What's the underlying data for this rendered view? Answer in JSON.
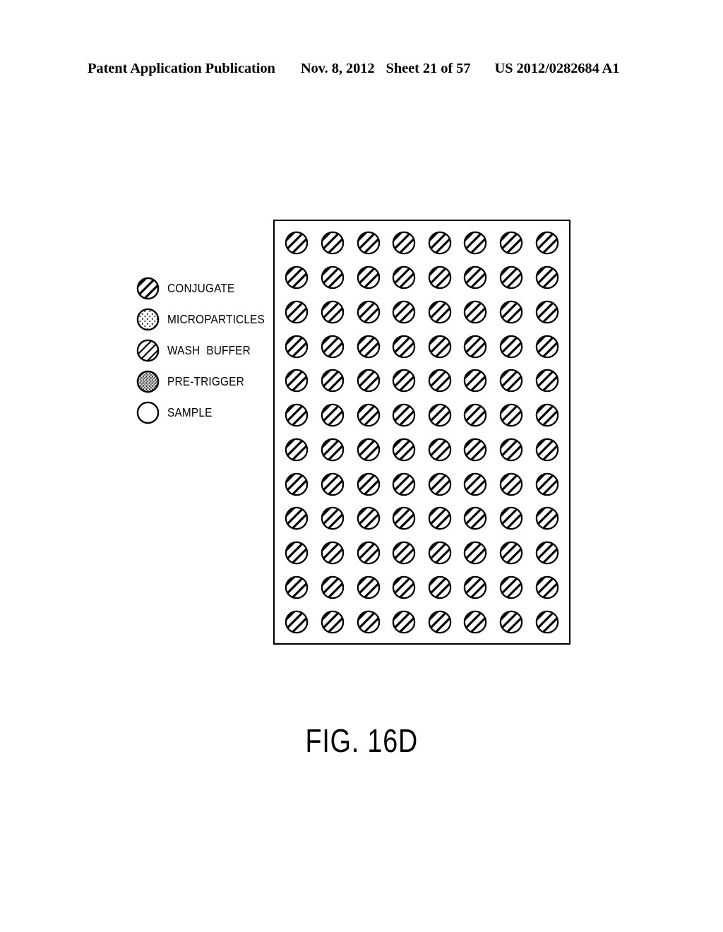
{
  "header": {
    "publication": "Patent Application Publication",
    "date": "Nov. 8, 2012",
    "sheet": "Sheet 21 of 57",
    "doc_number": "US 2012/0282684 A1"
  },
  "figure": {
    "caption": "FIG. 16D"
  },
  "legend": {
    "items": [
      {
        "label": "CONJUGATE",
        "pattern": "diagonal-stripes-thick",
        "icon": "conjugate-swatch-icon"
      },
      {
        "label": "MICROPARTICLES",
        "pattern": "sparse-dots",
        "icon": "microparticles-swatch-icon"
      },
      {
        "label": "WASH  BUFFER",
        "pattern": "diagonal-stripes-thin",
        "icon": "wash-buffer-swatch-icon"
      },
      {
        "label": "PRE-TRIGGER",
        "pattern": "dense-stipple",
        "icon": "pre-trigger-swatch-icon"
      },
      {
        "label": "SAMPLE",
        "pattern": "empty",
        "icon": "sample-swatch-icon"
      }
    ]
  },
  "plate": {
    "columns": 8,
    "rows": 12,
    "well_count": 96,
    "well_fill": "diagonal-stripes-thick",
    "well_fill_label": "CONJUGATE"
  },
  "colors": {
    "ink": "#000000",
    "page_background": "#ffffff"
  }
}
